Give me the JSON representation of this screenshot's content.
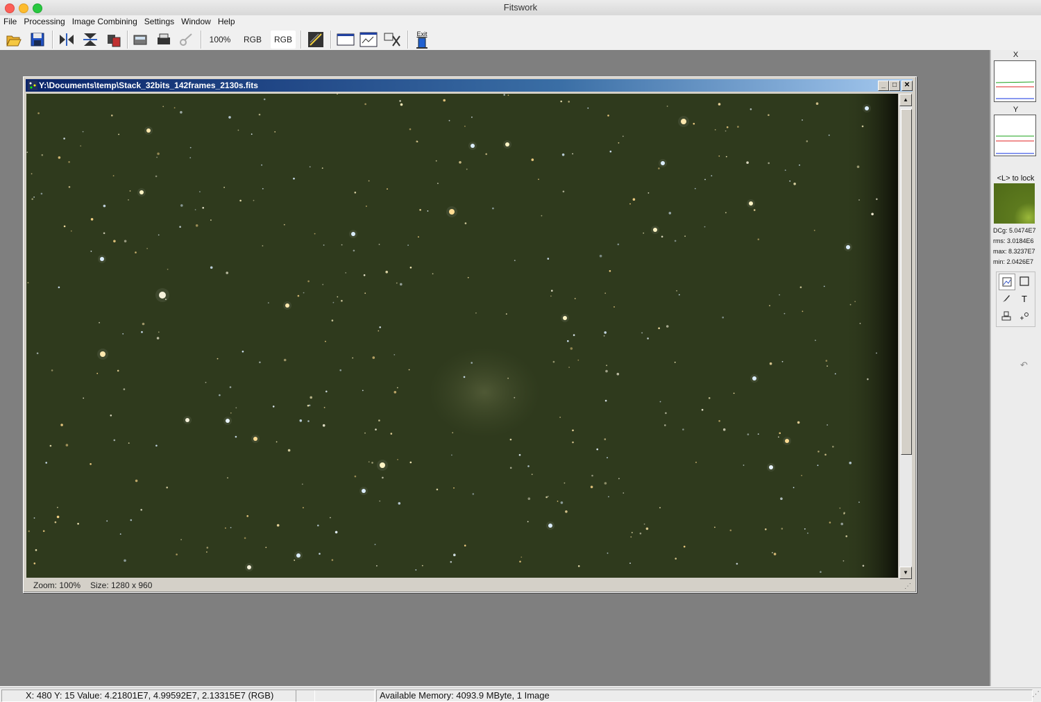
{
  "app": {
    "title": "Fitswork"
  },
  "menu": [
    "File",
    "Processing",
    "Image Combining",
    "Settings",
    "Window",
    "Help"
  ],
  "toolbar": {
    "zoom_label": "100%",
    "rgb_label_1": "RGB",
    "rgb_label_2": "RGB",
    "exit_label": "Exit",
    "icons": [
      "open-folder-icon",
      "save-disk-icon",
      "flip-horizontal-icon",
      "flip-vertical-icon",
      "rotate-icon",
      "scan-icon",
      "print-icon",
      "disabled-tool-icon",
      "histogram-icon",
      "window-icon",
      "chart-window-icon",
      "tools-icon",
      "exit-door-icon"
    ]
  },
  "image_window": {
    "title": "Y:\\Documents\\temp\\Stack_32bits_142frames_2130s.fits",
    "zoom_text": "Zoom: 100%",
    "size_text": "Size: 1280 x 960"
  },
  "right_panel": {
    "x_label": "X",
    "y_label": "Y",
    "lock_label": "<L> to lock",
    "stats": {
      "dcg": "DCg: 5.0474E7",
      "rms": "rms: 3.0184E6",
      "max": "max: 8.3237E7",
      "min": "min: 2.0426E7"
    },
    "tools": [
      "image-tool-icon",
      "rectangle-tool-icon",
      "pen-tool-icon",
      "text-tool-icon",
      "stamp-tool-icon",
      "add-point-tool-icon",
      "undo-icon"
    ],
    "colors": {
      "preview": "#5d7a1e",
      "graph_red": "#e02020",
      "graph_green": "#18a018",
      "graph_blue": "#1030e0"
    }
  },
  "status": {
    "position": "X: 480  Y: 15  Value: 4.21801E7, 4.99592E7, 2.13315E7 (RGB)",
    "middle": "",
    "memory": "Available Memory: 4093.9 MByte, 1 Image"
  }
}
